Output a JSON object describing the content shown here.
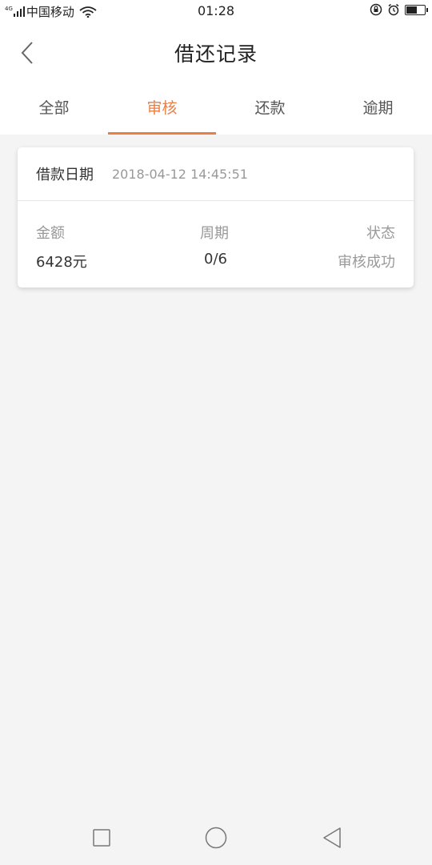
{
  "status_bar": {
    "network": "4G",
    "carrier": "中国移动",
    "time": "01:28",
    "battery_level": 0.55,
    "icons": [
      "signal-icon",
      "wifi-icon",
      "rotation-lock-icon",
      "alarm-icon",
      "battery-icon"
    ]
  },
  "header": {
    "title": "借还记录",
    "back_icon": "chevron-left-icon"
  },
  "tabs": [
    {
      "label": "全部",
      "active": false
    },
    {
      "label": "审核",
      "active": true
    },
    {
      "label": "还款",
      "active": false
    },
    {
      "label": "逾期",
      "active": false
    }
  ],
  "accent_color": "#ee7d42",
  "record": {
    "date_label": "借款日期",
    "date_value": "2018-04-12 14:45:51",
    "amount_label": "金额",
    "amount_value": "6428元",
    "period_label": "周期",
    "period_value": "0/6",
    "status_label": "状态",
    "status_value": "审核成功"
  },
  "nav_bar": {
    "icons": [
      "recent-apps-icon",
      "home-icon",
      "back-icon"
    ]
  }
}
